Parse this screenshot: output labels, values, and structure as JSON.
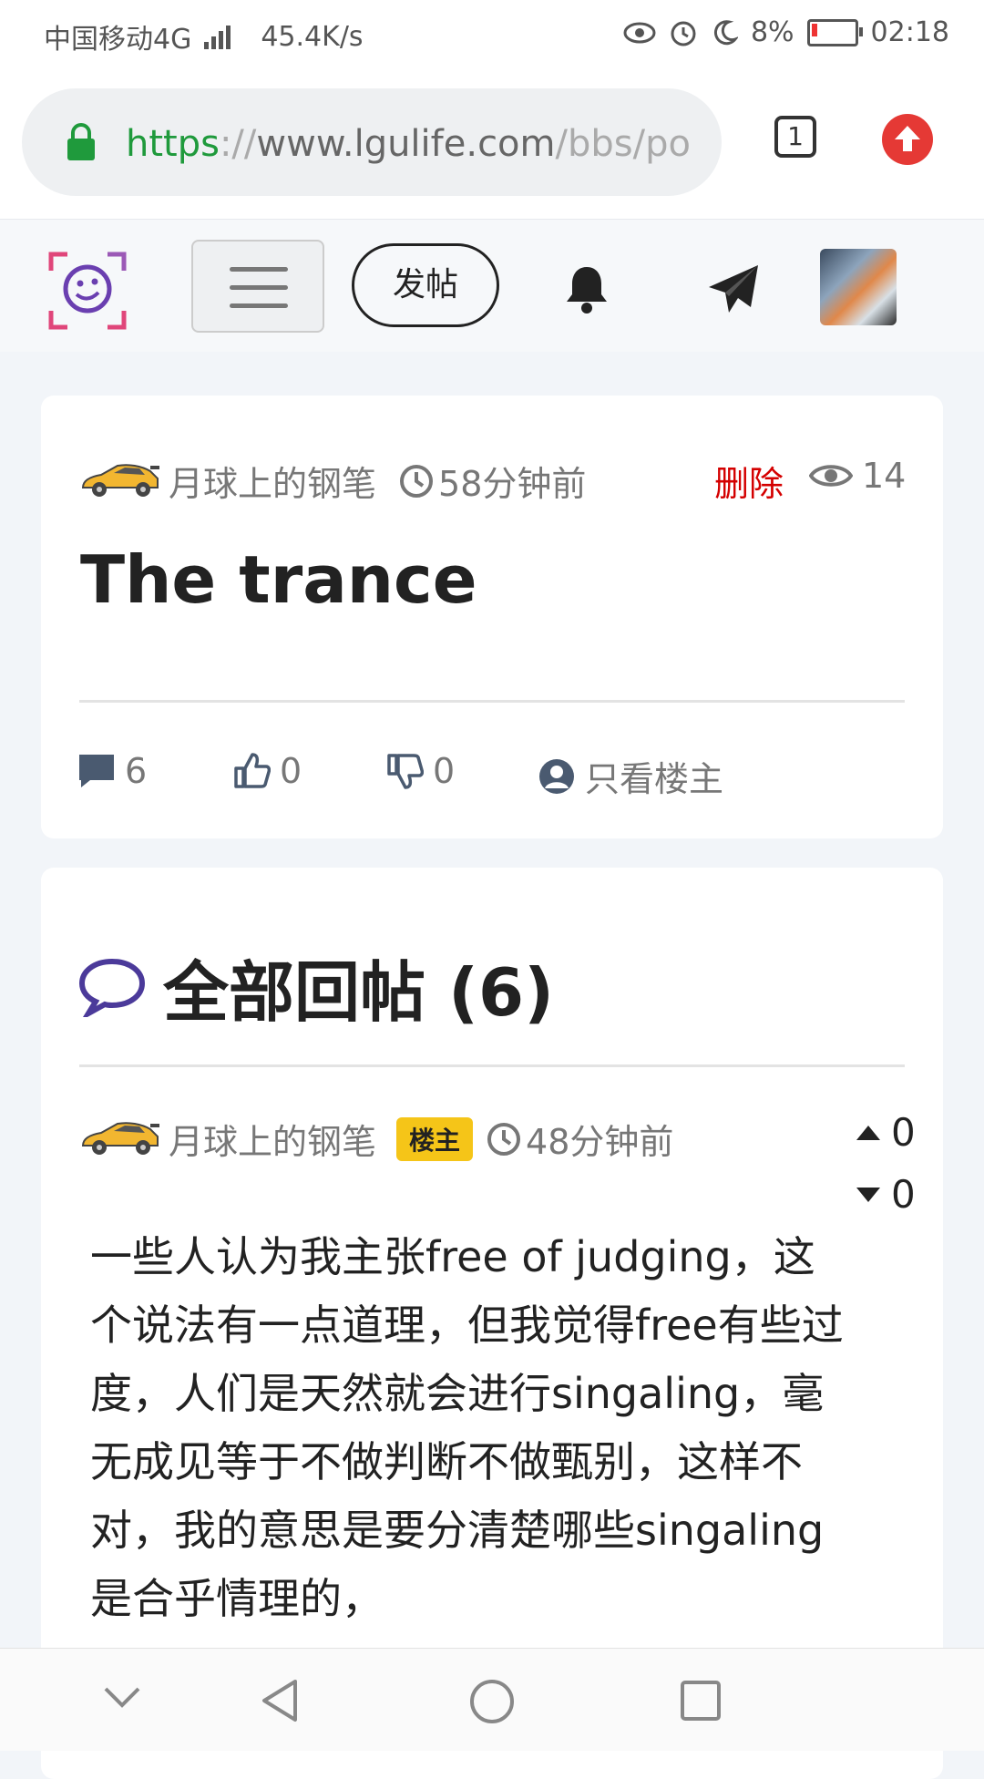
{
  "status_bar": {
    "carrier": "中国移动4G",
    "speed": "45.4K/s",
    "battery": "8%",
    "time": "02:18"
  },
  "browser": {
    "url_protocol": "https",
    "url_sep": "://",
    "url_host": "www.lgulife.com",
    "url_path": "/bbs/po",
    "tab_count": "1"
  },
  "nav": {
    "post_label": "发帖"
  },
  "post": {
    "author": "月球上的钢笔",
    "time": "58分钟前",
    "delete_label": "删除",
    "views": "14",
    "title": "The trance",
    "comments": "6",
    "likes": "0",
    "dislikes": "0",
    "only_op_label": "只看楼主"
  },
  "replies": {
    "header": "全部回帖 (6)",
    "items": [
      {
        "author": "月球上的钢笔",
        "badge": "楼主",
        "time": "48分钟前",
        "upvotes": "0",
        "downvotes": "0",
        "body": "一些人认为我主张free of judging，这个说法有一点道理，但我觉得free有些过度，人们是天然就会进行singaling，毫无成见等于不做判断不做甄别，这样不对，我的意思是要分清楚哪些singaling是合乎情理的，"
      }
    ]
  },
  "colors": {
    "accent_red": "#d40000",
    "badge_yellow": "#f5c518",
    "url_green": "#1f9a3c"
  }
}
